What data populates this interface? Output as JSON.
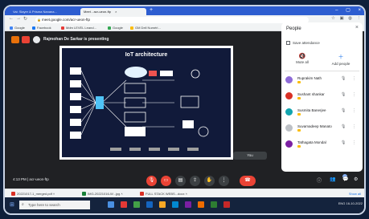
{
  "browser": {
    "tabs": [
      {
        "label": "Vai: Slayer & Prisma Nanana...",
        "active": false
      },
      {
        "label": "Meet - acr-ueon-ftp",
        "active": true
      }
    ],
    "url": "meet.google.com/acr-ueon-ftp",
    "bookmarks": [
      "Google",
      "Facebook",
      "Mdm LEVEL Leand...",
      "Google",
      "GM Dell Numéri..."
    ],
    "bookmark_right": "Other bookmarks"
  },
  "meet": {
    "presenting_text": "Rajmohan De Sarkar is presenting",
    "slide_title": "IoT architecture",
    "tile_controls": "You",
    "meeting_code": "4:13 PM | acr-ueon-ftp"
  },
  "people_panel": {
    "title": "People",
    "save_attendance": "Save attendance",
    "mute_all": "Mute all",
    "add_people": "Add people",
    "participants": [
      {
        "name": "Ruprakim Nath",
        "color": "#8e6bd8"
      },
      {
        "name": "Sushant shankar",
        "color": "#d93025"
      },
      {
        "name": "Susmita Banerjee",
        "color": "#12a4af"
      },
      {
        "name": "Suvamadeep Manato",
        "color": "#bdc1c6"
      },
      {
        "name": "Tathagata Mondal",
        "color": "#7b1fa2"
      }
    ]
  },
  "downloads": [
    {
      "label": "20221017-1_merged.pdf",
      "color": "red"
    },
    {
      "label": "IMG-20221016-W...jpg",
      "color": "green"
    },
    {
      "label": "FULL STACK WEBS...docx",
      "color": "red"
    }
  ],
  "downloads_show_all": "Show all",
  "taskbar": {
    "search_placeholder": "Type here to search",
    "tray_text": "ENG  16-10-2022",
    "taskbar_icon_colors": [
      "#4a90e2",
      "#e53935",
      "#43a047",
      "#1565c0",
      "#f9a825",
      "#0288d1",
      "#7b1fa2",
      "#ef6c00",
      "#2e7d32",
      "#c62828"
    ]
  }
}
